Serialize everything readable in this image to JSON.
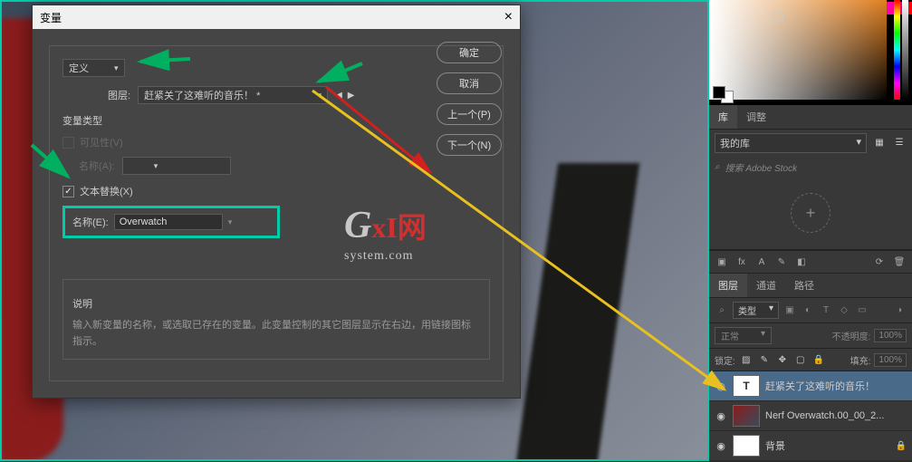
{
  "dialog": {
    "title": "变量",
    "define_dd": "定义",
    "layer_label": "图层:",
    "layer_value": "赶紧关了这难听的音乐！ *",
    "var_type": "变量类型",
    "visibility": "可见性(V)",
    "name_a": "名称(A):",
    "text_replace": "文本替换(X)",
    "name_e": "名称(E):",
    "name_value": "Overwatch",
    "desc_title": "说明",
    "desc_body": "输入新变量的名称，或选取已存在的变量。此变量控制的其它图层显示在右边，用链接图标指示。",
    "btn_ok": "确定",
    "btn_cancel": "取消",
    "btn_prev": "上一个(P)",
    "btn_next": "下一个(N)"
  },
  "panels": {
    "lib_tab": "库",
    "adjust_tab": "调整",
    "mylib": "我的库",
    "search_ph": "搜索 Adobe Stock",
    "layers_tab": "图层",
    "channels_tab": "通道",
    "paths_tab": "路径",
    "filter_kind": "类型",
    "blend_mode": "正常",
    "opacity_label": "不透明度:",
    "opacity_val": "100%",
    "lock_label": "锁定:",
    "fill_label": "填充:",
    "fill_val": "100%"
  },
  "layers": [
    {
      "name": "赶紧关了这难听的音乐！",
      "type": "T"
    },
    {
      "name": "Nerf Overwatch.00_00_2...",
      "type": "img"
    },
    {
      "name": "背景",
      "type": "bg",
      "locked": true
    }
  ],
  "watermark": {
    "g": "G",
    "xi": "xI",
    "net": "网",
    "sys": "system.com"
  }
}
